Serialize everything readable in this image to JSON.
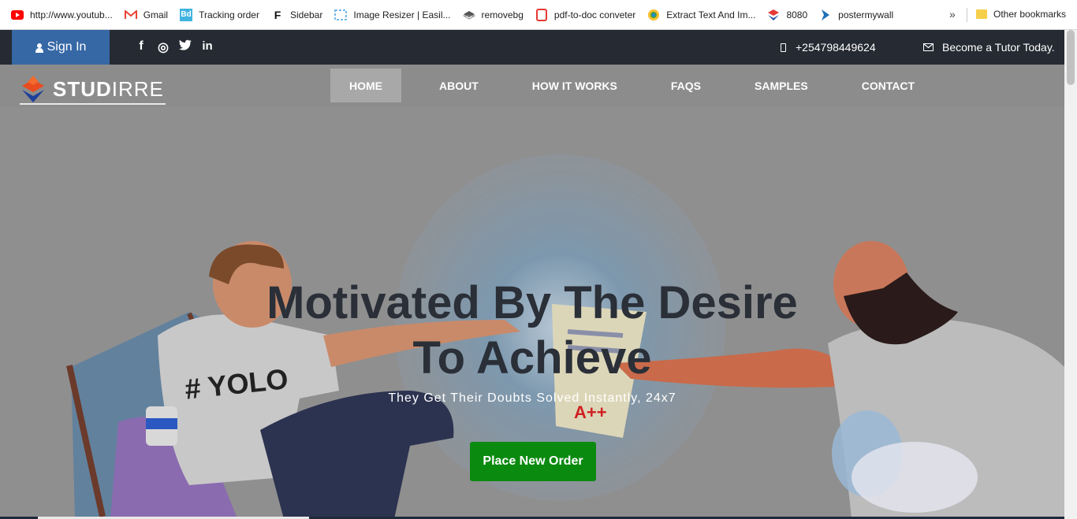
{
  "bookmarks": [
    {
      "label": "http://www.youtub...",
      "icon": "youtube-icon"
    },
    {
      "label": "Gmail",
      "icon": "gmail-icon"
    },
    {
      "label": "Tracking order",
      "icon": "bd-icon"
    },
    {
      "label": "Sidebar",
      "icon": "sidebar-f-icon"
    },
    {
      "label": "Image Resizer | Easil...",
      "icon": "image-resizer-icon"
    },
    {
      "label": "removebg",
      "icon": "removebg-icon"
    },
    {
      "label": "pdf-to-doc conveter",
      "icon": "pdf-icon"
    },
    {
      "label": "Extract Text And Im...",
      "icon": "extract-icon"
    },
    {
      "label": "8080",
      "icon": "stack-icon"
    },
    {
      "label": "postermywall",
      "icon": "postermywall-icon"
    }
  ],
  "bookmarks_more": "»",
  "other_bookmarks": "Other bookmarks",
  "topbar": {
    "signin": "Sign In",
    "social": [
      "f",
      "◎",
      "t",
      "in"
    ],
    "phone": "+254798449624",
    "tutor": "Become a Tutor Today."
  },
  "navbar": {
    "logo_bold": "STUD",
    "logo_light": "IRRE",
    "items": [
      "HOME",
      "ABOUT",
      "HOW IT WORKS",
      "FAQS",
      "SAMPLES",
      "CONTACT"
    ]
  },
  "hero": {
    "title": "Motivated By The Desire To Achieve",
    "subtitle": "They Get Their Doubts Solved Instantly, 24x7",
    "cta": "Place New Order",
    "illustration_shirt_text": "# YOLO"
  },
  "colors": {
    "topbar": "#252a33",
    "signin": "#3768a6",
    "navbar": "#8c8c8c",
    "cta": "#0b8a10",
    "title": "#2a2f38"
  }
}
